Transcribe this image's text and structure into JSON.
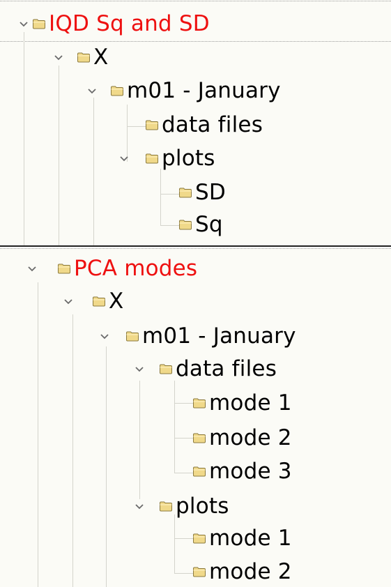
{
  "tree_top": {
    "root": {
      "label": "IQD Sq and SD",
      "color": "#ee1010"
    },
    "x": {
      "label": "X"
    },
    "month": {
      "label": "m01 - January"
    },
    "data_files": {
      "label": "data files"
    },
    "plots": {
      "label": "plots"
    },
    "sd": {
      "label": "SD"
    },
    "sq": {
      "label": "Sq"
    }
  },
  "tree_bottom": {
    "root": {
      "label": "PCA modes",
      "color": "#ee1010"
    },
    "x": {
      "label": "X"
    },
    "month": {
      "label": "m01 - January"
    },
    "data_files": {
      "label": "data files"
    },
    "df_mode1": {
      "label": "mode 1"
    },
    "df_mode2": {
      "label": "mode 2"
    },
    "df_mode3": {
      "label": "mode 3"
    },
    "plots": {
      "label": "plots"
    },
    "pl_mode1": {
      "label": "mode 1"
    },
    "pl_mode2": {
      "label": "mode 2"
    }
  },
  "icons": {
    "folder": "folder-icon",
    "expand": "chevron-down-icon"
  },
  "colors": {
    "folder_fill": "#f0d98a",
    "folder_stroke": "#8b7a3e",
    "guide_line": "#d4d4cc",
    "background": "#fbfbf6"
  }
}
